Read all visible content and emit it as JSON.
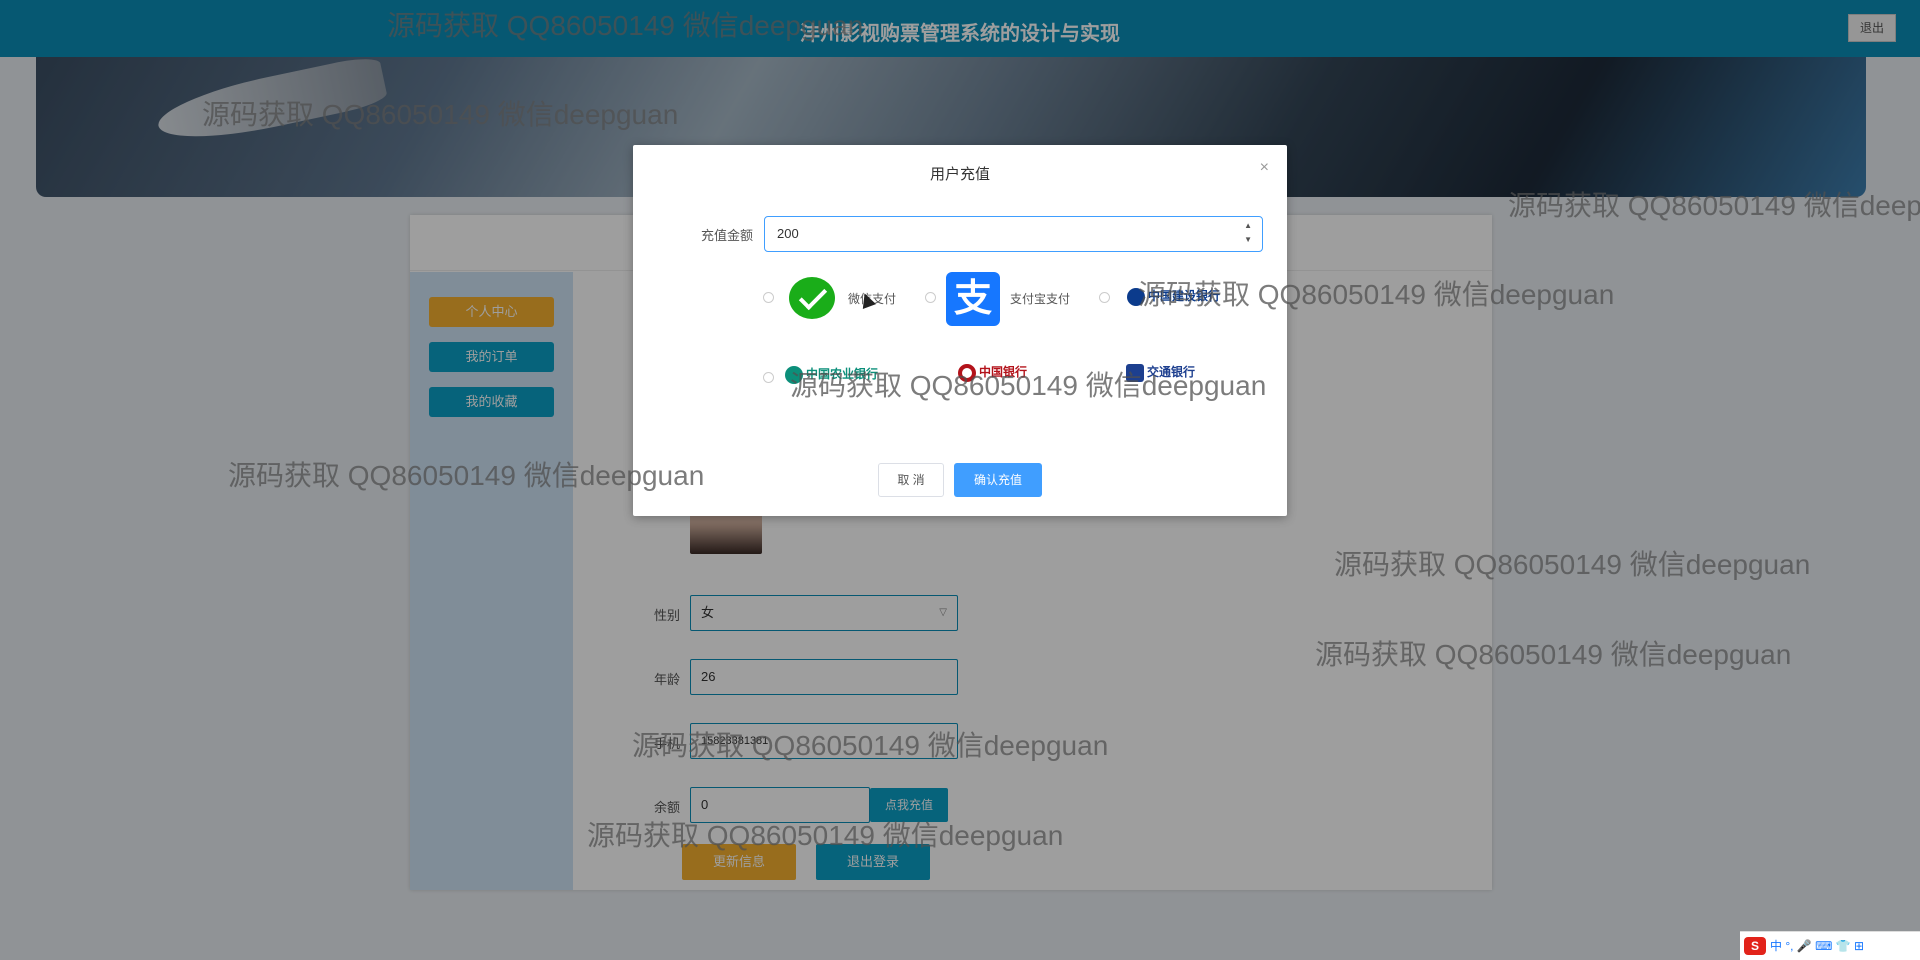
{
  "header": {
    "title": "沣州影视购票管理系统的设计与实现",
    "logout_label": "退出"
  },
  "sidebar": {
    "items": [
      {
        "label": "个人中心"
      },
      {
        "label": "我的订单"
      },
      {
        "label": "我的收藏"
      }
    ]
  },
  "profile_form": {
    "gender_label": "性别",
    "gender_value": "女",
    "age_label": "年龄",
    "age_value": "26",
    "phone_label": "手机",
    "phone_value": "15823381381",
    "balance_label": "余额",
    "balance_value": "0",
    "recharge_button": "点我充值",
    "update_button": "更新信息",
    "logout_button": "退出登录"
  },
  "dialog": {
    "title": "用户充值",
    "close_symbol": "×",
    "amount_label": "充值金额",
    "amount_value": "200",
    "payment_options": [
      {
        "label": "微信支付",
        "icon": "wechat-pay-icon"
      },
      {
        "label": "支付宝支付",
        "icon": "alipay-icon"
      },
      {
        "label": "中国建设银行",
        "icon": "ccb-icon"
      },
      {
        "label": "中国农业银行",
        "icon": "abc-icon"
      },
      {
        "label": "中国银行",
        "icon": "boc-icon"
      },
      {
        "label": "交通银行",
        "icon": "bocom-icon"
      }
    ],
    "cancel_label": "取 消",
    "confirm_label": "确认充值"
  },
  "watermark_text": "源码获取 QQ86050149 微信deepguan",
  "tray": {
    "lang": "中",
    "items": "°, 🎤 ⌨ 👕 ⊞"
  }
}
